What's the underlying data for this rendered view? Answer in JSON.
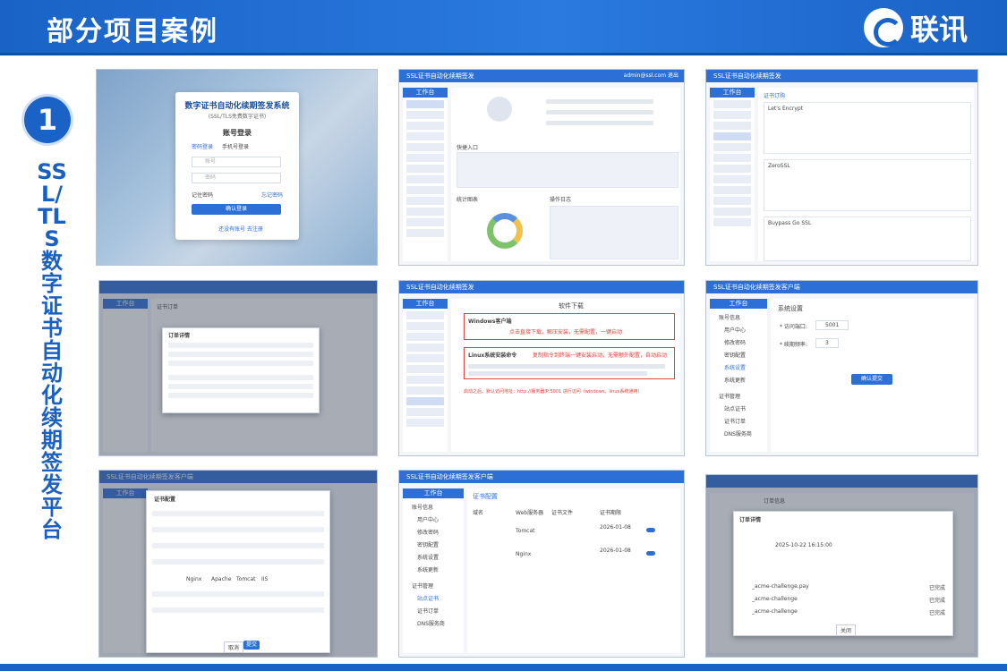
{
  "header": {
    "title": "部分项目案例",
    "logo_text": "联讯"
  },
  "section": {
    "number": "1",
    "title": "SSL/TLS数字证书自动化续期签发平台"
  },
  "accent_color": "#1a62c6",
  "screens": {
    "login": {
      "title": "数字证书自动化续期签发系统",
      "subtitle": "(SSL/TLS免费数字证书)",
      "heading": "账号登录",
      "tab1": "密码登录",
      "tab2": "手机号登录",
      "user_ph": "账号",
      "pwd_ph": "密码",
      "remember": "记住密码",
      "forgot": "忘记密码",
      "submit": "确认登录",
      "register": "还没有账号 去注册"
    },
    "s2": {
      "appbar": "SSL证书自动化续期签发",
      "sidebar_head": "工作台",
      "user": "admin@ssl.com 退出",
      "quick": "快捷入口",
      "stats": "统计图表",
      "logs": "操作日志"
    },
    "s3": {
      "appbar": "SSL证书自动化续期签发",
      "sidebar_head": "工作台",
      "section": "证书订购",
      "c1": "Let's Encrypt",
      "c2": "ZeroSSL",
      "c3": "Buypass Go SSL"
    },
    "s4": {
      "sidebar_head": "工作台",
      "tab": "证书订单",
      "modal": "订单详情"
    },
    "s5": {
      "appbar": "SSL证书自动化续期签发",
      "sidebar_head": "工作台",
      "title": "软件下载",
      "win": "Windows客户端",
      "win_note": "点击直接下载，解压安装，无需配置，一键启动",
      "linux": "Linux系统安装命令",
      "linux_note": "复制指令到终端一键安装启动，无需额外配置，自动启动",
      "footer_note": "启动之后，默认访问地址：http://服务器IP:5001 进行访问（windows、linux系统通用）"
    },
    "s6": {
      "appbar": "SSL证书自动化续期签发客户端",
      "sidebar_head": "工作台",
      "title": "系统设置",
      "port_label": "* 访问端口:",
      "port_val": "5001",
      "interval_label": "* 续期频率:",
      "interval_val": "3",
      "submit": "确认提交",
      "menu": [
        "账号信息",
        "用户中心",
        "修改密码",
        "密钥配置",
        "系统设置",
        "系统更新",
        "证书管理",
        "站点证书",
        "证书订单",
        "DNS服务商"
      ]
    },
    "s7": {
      "appbar": "SSL证书自动化续期签发客户端",
      "sidebar_head": "工作台",
      "modal": "证书配置",
      "opt1": "Nginx",
      "opt2": "Apache",
      "opt3": "Tomcat",
      "opt4": "IIS",
      "cancel": "取消",
      "ok": "提交"
    },
    "s8": {
      "appbar": "SSL证书自动化续期签发客户端",
      "sidebar_head": "工作台",
      "title": "证书配置",
      "col1": "域名",
      "col2": "Web服务器",
      "col3": "证书文件",
      "col4": "证书期限",
      "r1_server": "Tomcat",
      "r2_server": "Nginx",
      "r1_date": "2026-01-08",
      "r2_date": "2026-01-08",
      "menu": [
        "账号信息",
        "用户中心",
        "修改密码",
        "密钥配置",
        "系统设置",
        "系统更新",
        "证书管理",
        "站点证书",
        "证书订单",
        "DNS服务商"
      ]
    },
    "s9": {
      "tab": "订单信息",
      "modal": "订单详情",
      "date": "2025-10-22 16:15:00",
      "r1": "_acme-challenge.pay",
      "r2": "_acme-challenge",
      "r3": "_acme-challenge",
      "status": "已完成",
      "close": "关闭"
    }
  }
}
